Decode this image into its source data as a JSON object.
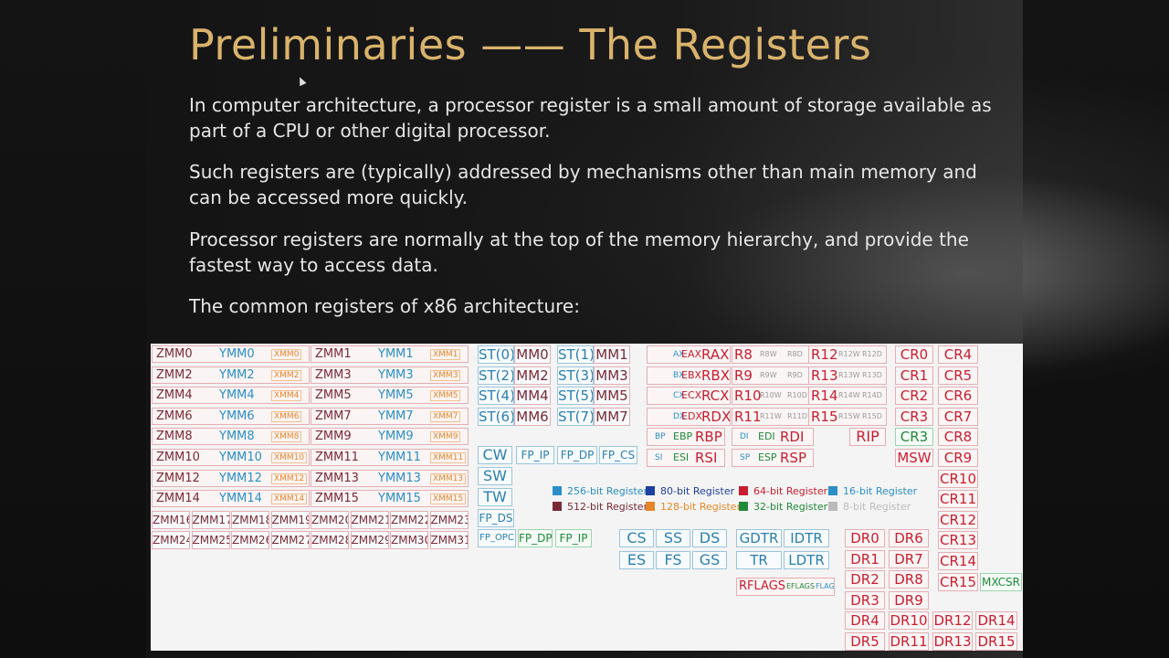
{
  "slide": {
    "title": "Preliminaries —— The Registers",
    "para1": "In computer architecture, a processor register is a small amount of storage available as part of a CPU or other digital processor.",
    "para2": "Such registers are (typically) addressed by mechanisms other than main memory and can be accessed more quickly.",
    "para3": "Processor registers are normally at the top of the memory hierarchy, and provide the fastest way to access data.",
    "para4": "The common registers of x86 architecture:"
  },
  "colors": {
    "title": "#d9b36c",
    "reg512": "#7a2a35",
    "reg256": "#2a8fc8",
    "reg128": "#e6862a",
    "reg80": "#1d3fa0",
    "reg64": "#c81e2f",
    "reg32": "#1e8a3a",
    "reg16": "#2a8fc8",
    "reg8": "#999999"
  },
  "diagram": {
    "zmm_rows": [
      [
        "ZMM0",
        "YMM0",
        "XMM0",
        "ZMM1",
        "YMM1",
        "XMM1"
      ],
      [
        "ZMM2",
        "YMM2",
        "XMM2",
        "ZMM3",
        "YMM3",
        "XMM3"
      ],
      [
        "ZMM4",
        "YMM4",
        "XMM4",
        "ZMM5",
        "YMM5",
        "XMM5"
      ],
      [
        "ZMM6",
        "YMM6",
        "XMM6",
        "ZMM7",
        "YMM7",
        "XMM7"
      ],
      [
        "ZMM8",
        "YMM8",
        "XMM8",
        "ZMM9",
        "YMM9",
        "XMM9"
      ],
      [
        "ZMM10",
        "YMM10",
        "XMM10",
        "ZMM11",
        "YMM11",
        "XMM11"
      ],
      [
        "ZMM12",
        "YMM12",
        "XMM12",
        "ZMM13",
        "YMM13",
        "XMM13"
      ],
      [
        "ZMM14",
        "YMM14",
        "XMM14",
        "ZMM15",
        "YMM15",
        "XMM15"
      ]
    ],
    "zmm_small_rows": [
      [
        "ZMM16",
        "ZMM17",
        "ZMM18",
        "ZMM19",
        "ZMM20",
        "ZMM21",
        "ZMM22",
        "ZMM23"
      ],
      [
        "ZMM24",
        "ZMM25",
        "ZMM26",
        "ZMM27",
        "ZMM28",
        "ZMM29",
        "ZMM30",
        "ZMM31"
      ]
    ],
    "st_rows": [
      [
        "ST(0)",
        "MM0",
        "ST(1)",
        "MM1"
      ],
      [
        "ST(2)",
        "MM2",
        "ST(3)",
        "MM3"
      ],
      [
        "ST(4)",
        "MM4",
        "ST(5)",
        "MM5"
      ],
      [
        "ST(6)",
        "MM6",
        "ST(7)",
        "MM7"
      ]
    ],
    "fpu": {
      "cw": "CW",
      "sw": "SW",
      "tw": "TW",
      "fp_ip": "FP_IP",
      "fp_dp": "FP_DP",
      "fp_cs": "FP_CS",
      "fp_ds": "FP_DS",
      "fp_opc": "FP_OPC",
      "fp_dp2": "FP_DP",
      "fp_ip2": "FP_IP"
    },
    "gpr_rows": [
      [
        "AX",
        "EAX",
        "RAX"
      ],
      [
        "BX",
        "EBX",
        "RBX"
      ],
      [
        "CX",
        "ECX",
        "RCX"
      ],
      [
        "DX",
        "EDX",
        "RDX"
      ]
    ],
    "gpr_ptr": [
      [
        "BP",
        "EBP",
        "RBP"
      ],
      [
        "SI",
        "ESI",
        "RSI"
      ],
      [
        "DI",
        "EDI",
        "RDI"
      ],
      [
        "SP",
        "ESP",
        "RSP"
      ]
    ],
    "r_rows": [
      [
        "R8",
        "R8W",
        "R8D",
        "R12",
        "R12W",
        "R12D"
      ],
      [
        "R9",
        "R9W",
        "R9D",
        "R13",
        "R13W",
        "R13D"
      ],
      [
        "R10",
        "R10W",
        "R10D",
        "R14",
        "R14W",
        "R14D"
      ],
      [
        "R11",
        "R11W",
        "R11D",
        "R15",
        "R15W",
        "R15D"
      ]
    ],
    "rip": "RIP",
    "cr_left": [
      "CR0",
      "CR1",
      "CR2",
      "CR3",
      "CR3",
      "MSW"
    ],
    "cr_right": [
      "CR4",
      "CR5",
      "CR6",
      "CR7",
      "CR8",
      "CR9",
      "CR10",
      "CR11",
      "CR12",
      "CR13",
      "CR14",
      "CR15"
    ],
    "mxcsr": "MXCSR",
    "segments": [
      "CS",
      "SS",
      "DS",
      "ES",
      "FS",
      "GS"
    ],
    "tables": [
      "GDTR",
      "IDTR",
      "TR",
      "LDTR"
    ],
    "rflags": "RFLAGS",
    "eflags": "EFLAGS",
    "flags": "FLAGS",
    "dr_left": [
      "DR0",
      "DR1",
      "DR2",
      "DR3",
      "DR4",
      "DR5"
    ],
    "dr_mid": [
      "DR6",
      "DR7",
      "DR8",
      "DR9",
      "DR10",
      "DR11"
    ],
    "dr_right": [
      "DR12",
      "DR13"
    ],
    "dr_far": [
      "DR14",
      "DR15"
    ],
    "legend": [
      {
        "label": "256-bit Register",
        "color": "#2a8fc8"
      },
      {
        "label": "80-bit Register",
        "color": "#1d3fa0"
      },
      {
        "label": "64-bit Register",
        "color": "#c81e2f"
      },
      {
        "label": "16-bit Register",
        "color": "#2a8fc8"
      },
      {
        "label": "512-bit Register",
        "color": "#7a2a35"
      },
      {
        "label": "128-bit Register",
        "color": "#e6862a"
      },
      {
        "label": "32-bit Register",
        "color": "#1e8a3a"
      },
      {
        "label": "8-bit Register",
        "color": "#bbbbbb"
      }
    ]
  }
}
